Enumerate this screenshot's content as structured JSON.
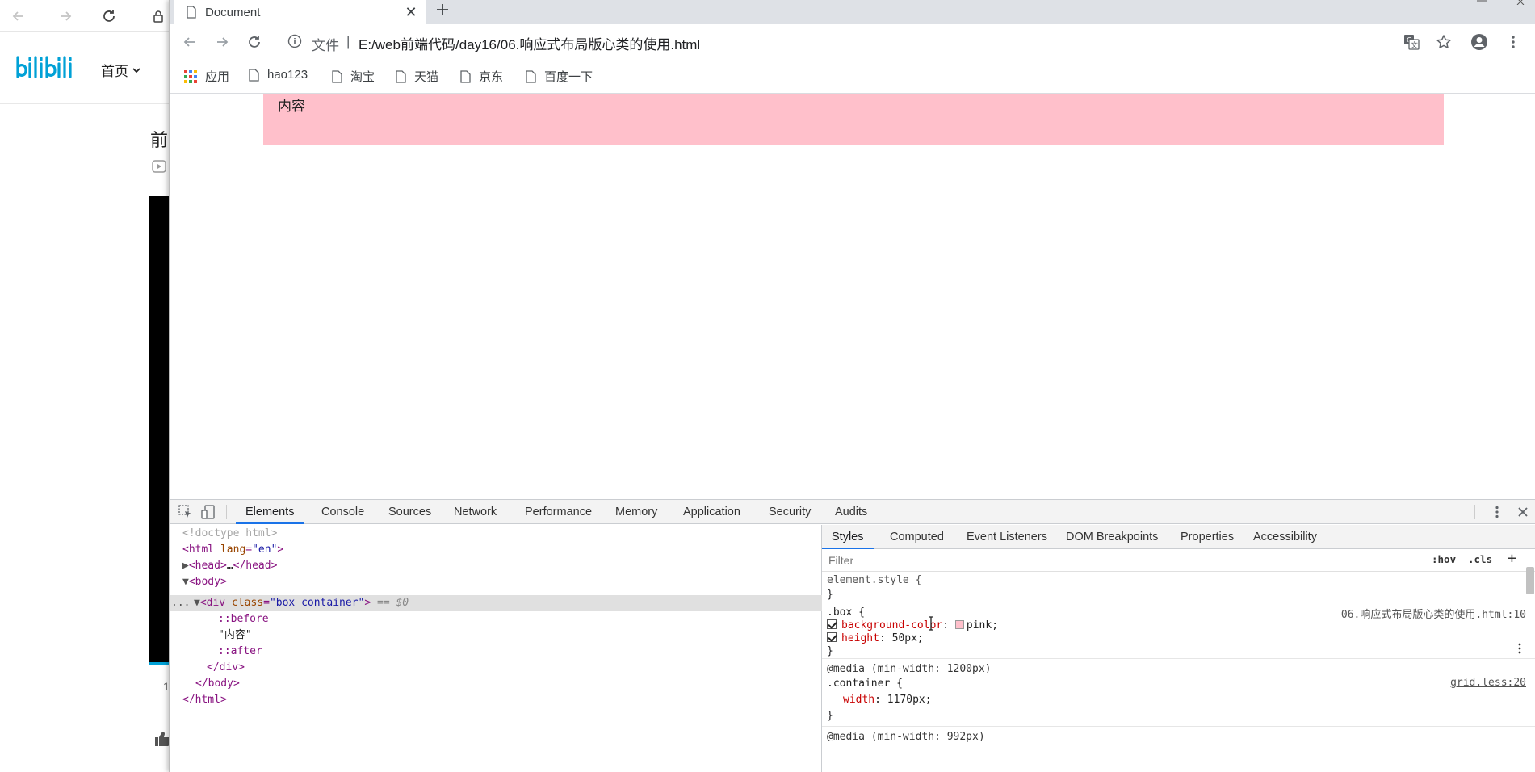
{
  "background_window": {
    "nav_home": "首页",
    "title_char": "前",
    "small_text": "1"
  },
  "browser": {
    "tab_title": "Document",
    "scheme_label": "文件",
    "separator": "|",
    "url": "E:/web前端代码/day16/06.响应式布局版心类的使用.html",
    "bookmarks": [
      {
        "label": "应用",
        "icon": "apps-grid-icon"
      },
      {
        "label": "hao123",
        "icon": "page-icon"
      },
      {
        "label": "淘宝",
        "icon": "page-icon"
      },
      {
        "label": "天猫",
        "icon": "page-icon"
      },
      {
        "label": "京东",
        "icon": "page-icon"
      },
      {
        "label": "百度一下",
        "icon": "page-icon"
      }
    ]
  },
  "page": {
    "box_text": "内容",
    "box_color": "#ffc0cb"
  },
  "devtools": {
    "tabs": [
      "Elements",
      "Console",
      "Sources",
      "Network",
      "Performance",
      "Memory",
      "Application",
      "Security",
      "Audits"
    ],
    "dom": {
      "doctype": "<!doctype html>",
      "html_open_tag": "html",
      "lang_attr": "lang",
      "lang_val": "\"en\"",
      "head": "head",
      "head_ellipsis": "…",
      "body": "body",
      "div_tag": "div",
      "class_attr": "class",
      "class_val": "\"box container\"",
      "selected_hint": "== $0",
      "before": "::before",
      "text_node": "\"内容\"",
      "after": "::after",
      "div_close": "</div>",
      "body_close": "</body>",
      "html_close": "</html>",
      "ellipsis_dots": "..."
    },
    "styles_tabs": [
      "Styles",
      "Computed",
      "Event Listeners",
      "DOM Breakpoints",
      "Properties",
      "Accessibility"
    ],
    "filter_placeholder": "Filter",
    "hov": ":hov",
    "cls": ".cls",
    "add": "+",
    "rules": {
      "element_style": "element.style {",
      "close_brace": "}",
      "box_selector": ".box {",
      "box_source": "06.响应式布局版心类的使用.html:10",
      "bg_prop": "background-color",
      "bg_val": "pink;",
      "height_prop": "height",
      "height_val": "50px;",
      "media1": "@media (min-width: 1200px)",
      "container_selector": ".container {",
      "container_source": "grid.less:20",
      "width_prop": "width",
      "width_val": "1170px;",
      "media2": "@media (min-width: 992px)"
    }
  }
}
